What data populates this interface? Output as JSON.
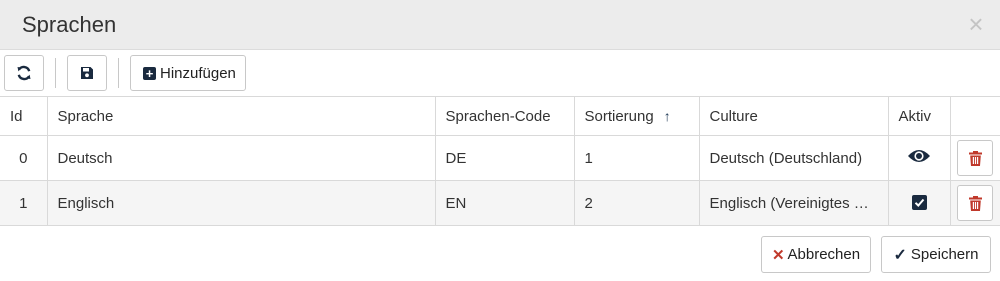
{
  "dialog": {
    "title": "Sprachen",
    "close_glyph": "×"
  },
  "toolbar": {
    "refresh_icon": "refresh-icon",
    "save_icon": "floppy-disk-icon",
    "add_label": "Hinzufügen",
    "add_glyph": "+"
  },
  "table": {
    "columns": [
      "Id",
      "Sprache",
      "Sprachen-Code",
      "Sortierung",
      "Culture",
      "Aktiv",
      ""
    ],
    "sort_glyph": "↑",
    "rows": [
      {
        "id": "0",
        "language": "Deutsch",
        "code": "DE",
        "sort": "1",
        "culture": "Deutsch (Deutschland)",
        "active_display": "eye"
      },
      {
        "id": "1",
        "language": "Englisch",
        "code": "EN",
        "sort": "2",
        "culture": "Englisch (Vereinigtes Königreich)",
        "active_display": "checkbox-checked"
      }
    ]
  },
  "footer": {
    "cancel_label": "Abbrechen",
    "cancel_glyph": "✕",
    "save_label": "Speichern",
    "save_glyph": "✓"
  },
  "colors": {
    "header_bg": "#ececec",
    "accent_dark": "#1a2a3f",
    "delete_red": "#c0392b",
    "alt_row": "#f5f5f5"
  }
}
